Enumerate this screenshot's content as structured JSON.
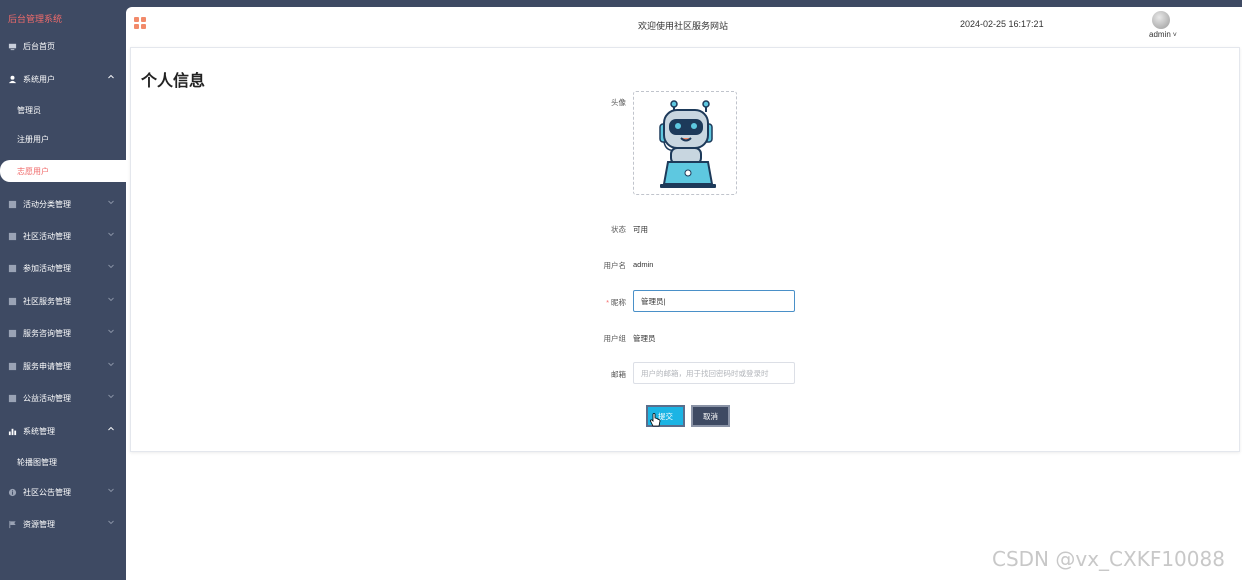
{
  "app": {
    "title": "后台管理系统"
  },
  "sidebar": {
    "items": [
      {
        "label": "后台首页"
      },
      {
        "label": "系统用户",
        "sub": [
          "管理员",
          "注册用户",
          "志愿用户"
        ],
        "active_sub": "志愿用户"
      },
      {
        "label": "活动分类管理"
      },
      {
        "label": "社区活动管理"
      },
      {
        "label": "参加活动管理"
      },
      {
        "label": "社区服务管理"
      },
      {
        "label": "服务咨询管理"
      },
      {
        "label": "服务申请管理"
      },
      {
        "label": "公益活动管理"
      },
      {
        "label": "系统管理",
        "sub": [
          "轮播图管理"
        ]
      },
      {
        "label": "社区公告管理"
      },
      {
        "label": "资源管理"
      }
    ]
  },
  "header": {
    "welcome": "欢迎使用社区服务网站",
    "datetime": "2024-02-25 16:17:21",
    "user": "admin"
  },
  "page": {
    "title": "个人信息",
    "form": {
      "avatar_label": "头像",
      "status_label": "状态",
      "status_value": "可用",
      "username_label": "用户名",
      "username_value": "admin",
      "nickname_label": "昵称",
      "nickname_value": "管理员",
      "group_label": "用户组",
      "group_value": "管理员",
      "email_label": "邮箱",
      "email_placeholder": "用户的邮箱，用于找回密码时或登录时"
    },
    "buttons": {
      "submit": "提交",
      "cancel": "取消"
    }
  },
  "watermark": "CSDN @vx_CXKF10088",
  "colors": {
    "sidebar_bg": "#3e4a63",
    "accent_red": "#f06b6b",
    "submit_bg": "#1bb4e4"
  }
}
